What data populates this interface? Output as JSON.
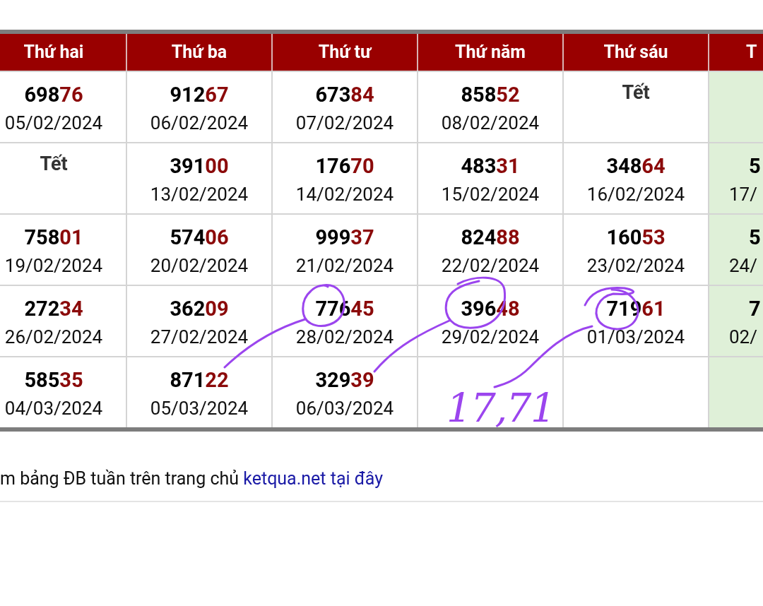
{
  "columns": [
    {
      "label": "Thứ hai",
      "highlighted": false
    },
    {
      "label": "Thứ ba",
      "highlighted": false
    },
    {
      "label": "Thứ tư",
      "highlighted": false
    },
    {
      "label": "Thứ năm",
      "highlighted": false
    },
    {
      "label": "Thứ sáu",
      "highlighted": false
    },
    {
      "label": "T",
      "highlighted": true
    }
  ],
  "rows": [
    {
      "cells": [
        {
          "kind": "result",
          "head": "698",
          "tail": "76",
          "date": "05/02/2024"
        },
        {
          "kind": "result",
          "head": "912",
          "tail": "67",
          "date": "06/02/2024"
        },
        {
          "kind": "result",
          "head": "673",
          "tail": "84",
          "date": "07/02/2024"
        },
        {
          "kind": "result",
          "head": "858",
          "tail": "52",
          "date": "08/02/2024"
        },
        {
          "kind": "holiday",
          "label": "Tết"
        },
        {
          "kind": "empty"
        }
      ]
    },
    {
      "cells": [
        {
          "kind": "holiday",
          "label": "Tết"
        },
        {
          "kind": "result",
          "head": "391",
          "tail": "00",
          "date": "13/02/2024"
        },
        {
          "kind": "result",
          "head": "176",
          "tail": "70",
          "date": "14/02/2024"
        },
        {
          "kind": "result",
          "head": "483",
          "tail": "31",
          "date": "15/02/2024"
        },
        {
          "kind": "result",
          "head": "348",
          "tail": "64",
          "date": "16/02/2024"
        },
        {
          "kind": "result",
          "head": "5",
          "date": "17/"
        }
      ]
    },
    {
      "cells": [
        {
          "kind": "result",
          "head": "758",
          "tail": "01",
          "date": "19/02/2024"
        },
        {
          "kind": "result",
          "head": "574",
          "tail": "06",
          "date": "20/02/2024"
        },
        {
          "kind": "result",
          "head": "999",
          "tail": "37",
          "date": "21/02/2024"
        },
        {
          "kind": "result",
          "head": "824",
          "tail": "88",
          "date": "22/02/2024"
        },
        {
          "kind": "result",
          "head": "160",
          "tail": "53",
          "date": "23/02/2024"
        },
        {
          "kind": "result",
          "head": "5",
          "date": "24/"
        }
      ]
    },
    {
      "cells": [
        {
          "kind": "result",
          "head": "272",
          "tail": "34",
          "date": "26/02/2024"
        },
        {
          "kind": "result",
          "head": "362",
          "tail": "09",
          "date": "27/02/2024"
        },
        {
          "kind": "result",
          "head": "776",
          "tail": "45",
          "date": "28/02/2024"
        },
        {
          "kind": "result",
          "head": "396",
          "tail": "48",
          "date": "29/02/2024"
        },
        {
          "kind": "result",
          "head": "719",
          "tail": "61",
          "date": "01/03/2024"
        },
        {
          "kind": "result",
          "head": "7",
          "date": "02/"
        }
      ]
    },
    {
      "cells": [
        {
          "kind": "result",
          "head": "585",
          "tail": "35",
          "date": "04/03/2024"
        },
        {
          "kind": "result",
          "head": "871",
          "tail": "22",
          "date": "05/03/2024"
        },
        {
          "kind": "result",
          "head": "329",
          "tail": "39",
          "date": "06/03/2024"
        },
        {
          "kind": "empty"
        },
        {
          "kind": "empty"
        },
        {
          "kind": "empty"
        }
      ]
    }
  ],
  "footer": {
    "text": "m bảng ĐB tuần trên trang chủ",
    "link": "ketqua.net tại đây"
  },
  "handwritten_note": "17,71"
}
